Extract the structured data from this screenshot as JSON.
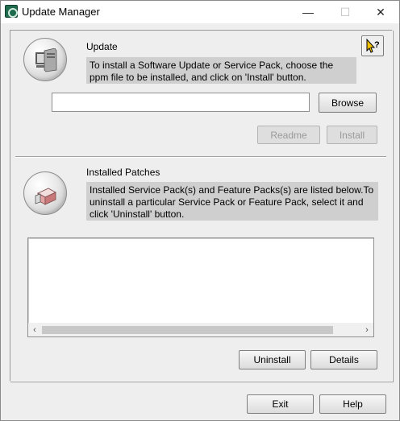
{
  "window": {
    "title": "Update Manager",
    "controls": {
      "minimize": "—",
      "maximize": "☐",
      "close": "✕"
    }
  },
  "update": {
    "heading": "Update",
    "description": "To install a Software Update or Service Pack, choose the ppm file to be installed, and click on 'Install' button.",
    "file_path_value": "",
    "browse_label": "Browse",
    "readme_label": "Readme",
    "install_label": "Install",
    "icon": "computer-icon"
  },
  "patches": {
    "heading": "Installed Patches",
    "description": "Installed Service Pack(s) and Feature Packs(s) are listed below.To uninstall a particular Service Pack or Feature Pack, select it and click 'Uninstall' button.",
    "items": [],
    "uninstall_label": "Uninstall",
    "details_label": "Details",
    "icon": "patch-icon",
    "scroll_left": "‹",
    "scroll_right": "›"
  },
  "footer": {
    "exit_label": "Exit",
    "help_label": "Help"
  },
  "context_help": {
    "glyph": "?",
    "icon": "help-cursor-icon"
  },
  "colors": {
    "background": "#eeeeee",
    "info_box": "#cfcfcf",
    "disabled_text": "#9a9a9a"
  }
}
